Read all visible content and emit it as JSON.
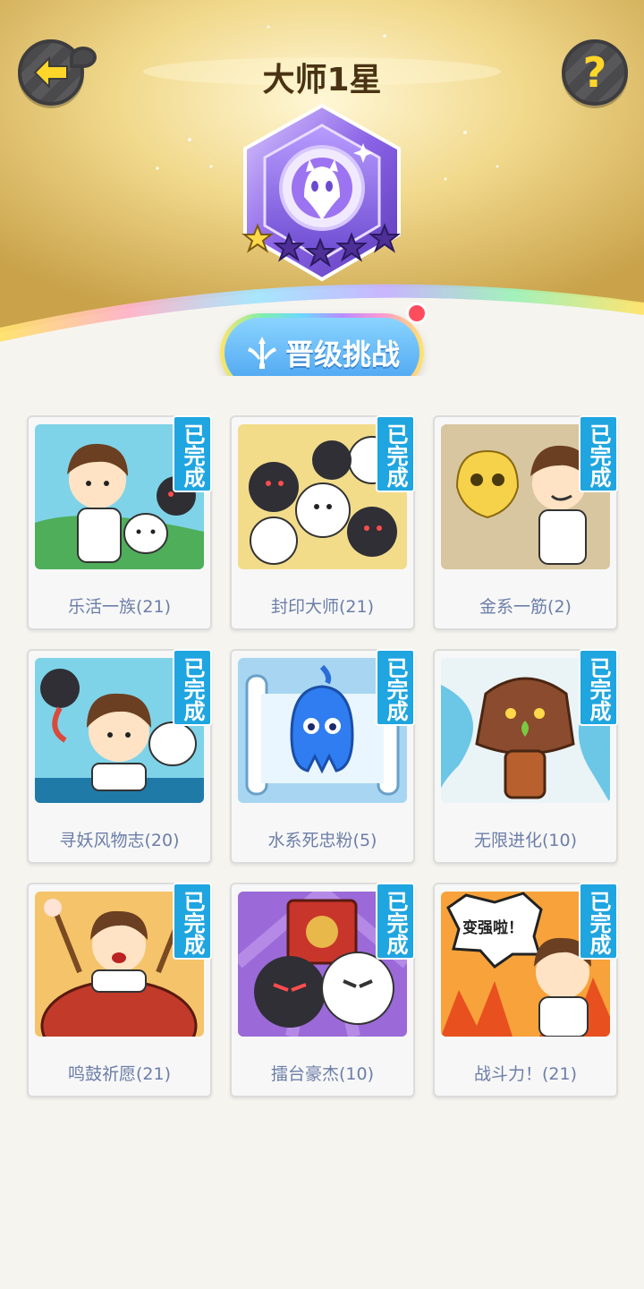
{
  "header": {
    "title": "大师1星",
    "back_icon": "arrow-left-icon",
    "help_label": "?",
    "colors": {
      "gold": "#e8c766",
      "title": "#4a3314",
      "icon_yellow": "#ffd629"
    }
  },
  "badge": {
    "stars_total": 5,
    "stars_filled": 1,
    "icon": "horned-ghost-icon"
  },
  "challenge": {
    "label": "晋级挑战",
    "icon": "sword-icon"
  },
  "cards": [
    {
      "label": "乐活一族(21)",
      "status": "已完成",
      "art": "art-1"
    },
    {
      "label": "封印大师(21)",
      "status": "已完成",
      "art": "art-2"
    },
    {
      "label": "金系一筋(2)",
      "status": "已完成",
      "art": "art-3"
    },
    {
      "label": "寻妖风物志(20)",
      "status": "已完成",
      "art": "art-4"
    },
    {
      "label": "水系死忠粉(5)",
      "status": "已完成",
      "art": "art-5"
    },
    {
      "label": "无限进化(10)",
      "status": "已完成",
      "art": "art-6"
    },
    {
      "label": "鸣鼓祈愿(21)",
      "status": "已完成",
      "art": "art-7"
    },
    {
      "label": "擂台豪杰(10)",
      "status": "已完成",
      "art": "art-8"
    },
    {
      "label": "战斗力！(21)",
      "status": "已完成",
      "art": "art-9"
    }
  ],
  "art_text": {
    "boost": "变强啦！"
  }
}
